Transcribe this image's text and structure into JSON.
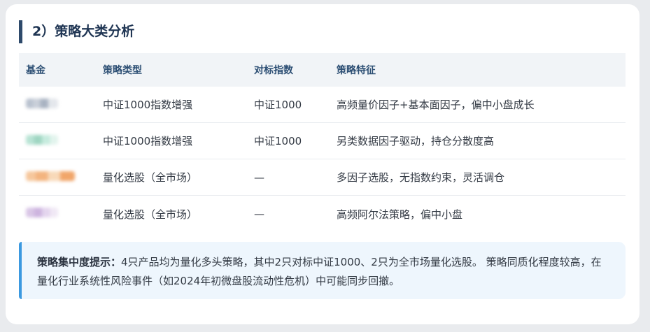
{
  "section": {
    "title": "2）策略大类分析"
  },
  "table": {
    "headers": [
      "基金",
      "策略类型",
      "对标指数",
      "策略特征"
    ],
    "rows": [
      {
        "fund_chip": "chip-0",
        "type": "中证1000指数增强",
        "index": "中证1000",
        "feature": "高频量价因子+基本面因子，偏中小盘成长"
      },
      {
        "fund_chip": "chip-1",
        "type": "中证1000指数增强",
        "index": "中证1000",
        "feature": "另类数据因子驱动，持仓分散度高"
      },
      {
        "fund_chip": "chip-2",
        "type": "量化选股（全市场）",
        "index": "—",
        "feature": "多因子选股，无指数约束，灵活调仓"
      },
      {
        "fund_chip": "chip-3",
        "type": "量化选股（全市场）",
        "index": "—",
        "feature": "高频阿尔法策略，偏中小盘"
      }
    ]
  },
  "note": {
    "label": "策略集中度提示：",
    "text": "4只产品均为量化多头策略，其中2只对标中证1000、2只为全市场量化选股。 策略同质化程度较高，在量化行业系统性风险事件（如2024年初微盘股流动性危机）中可能同步回撤。"
  },
  "colors": {
    "accent": "#3b99e0",
    "title_bar": "#2e4a6b",
    "header_bg": "#f1f4f7"
  }
}
